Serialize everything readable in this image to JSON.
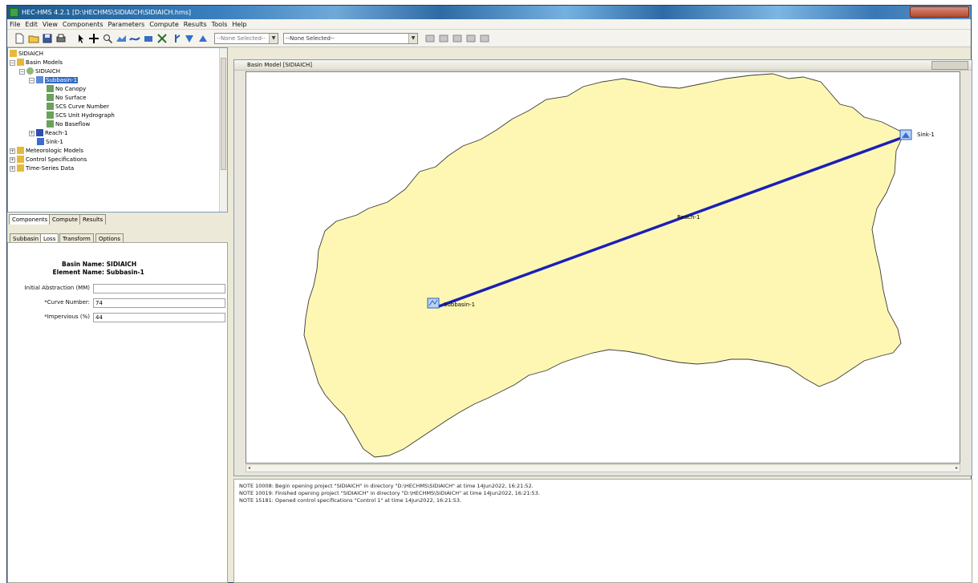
{
  "window": {
    "title": "HEC-HMS 4.2.1 [D:\\HECHMS\\SIDIAICH\\SIDIAICH.hms]"
  },
  "menu": [
    "File",
    "Edit",
    "View",
    "Components",
    "Parameters",
    "Compute",
    "Results",
    "Tools",
    "Help"
  ],
  "toolbar": {
    "selector_1": "--None Selected--",
    "selector_2": "--None Selected--"
  },
  "tree": {
    "root": "SIDIAICH",
    "basin_models": "Basin Models",
    "basin": "SIDIAICH",
    "subbasin": "Subbasin-1",
    "methods": [
      "No Canopy",
      "No Surface",
      "SCS Curve Number",
      "SCS Unit Hydrograph",
      "No Baseflow"
    ],
    "reach": "Reach-1",
    "sink": "Sink-1",
    "meteorologic": "Meteorologic Models",
    "control": "Control Specifications",
    "timeseries": "Time-Series Data"
  },
  "panel_tabs": [
    "Components",
    "Compute",
    "Results"
  ],
  "editor_tabs": [
    "Subbasin",
    "Loss",
    "Transform",
    "Options"
  ],
  "editor": {
    "basin_name_label": "Basin Name:",
    "basin_name": "SIDIAICH",
    "element_name_label": "Element Name:",
    "element_name": "Subbasin-1",
    "fields": [
      {
        "label": "Initial Abstraction (MM)",
        "value": ""
      },
      {
        "label": "*Curve Number:",
        "value": "74"
      },
      {
        "label": "*Impervious (%)",
        "value": "44"
      }
    ]
  },
  "basin_window": {
    "title": "Basin Model [SIDIAICH]"
  },
  "map": {
    "sink_label": "Sink-1",
    "reach_label": "Reach-1",
    "subbasin_label": "Subbasin-1",
    "polygon_fill": "#fdf7b3",
    "reach_color": "#1a1fb8"
  },
  "log": [
    "NOTE 10008:  Begin opening project \"SIDIAICH\" in directory \"D:\\HECHMS\\SIDIAICH\" at time 14Jun2022, 16:21:52.",
    "NOTE 10019:  Finished opening project \"SIDIAICH\" in directory \"D:\\HECHMS\\SIDIAICH\" at time 14Jun2022, 16:21:53.",
    "NOTE 15181:  Opened control specifications \"Control 1\" at time 14Jun2022, 16:21:53."
  ]
}
